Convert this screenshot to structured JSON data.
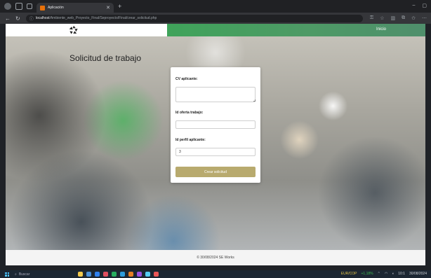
{
  "browser": {
    "tab_title": "Aplicación",
    "url_host": "localhost",
    "url_path": "/Ambiente_web_Proyecto_Final/Seproyecto/Final/crear_solicitud.php"
  },
  "header": {
    "nav_inicio": "Inicio"
  },
  "page": {
    "title": "Solicitud de trabajo"
  },
  "form": {
    "cv_label": "CV aplicante:",
    "cv_value": "",
    "oferta_label": "Id oferta trabajo:",
    "oferta_value": "",
    "perfil_label": "Id perfil aplicante:",
    "perfil_value": "3",
    "submit_label": "Crear solicitud"
  },
  "footer": {
    "text": "© 30/08/2024 SE Works"
  },
  "taskbar": {
    "search_label": "Buscar",
    "stock_label": "EUR/COP",
    "stock_change": "+1,18%",
    "time": "10:1",
    "date": "30/08/2024"
  },
  "colors": {
    "accent_green": "#3fa35a",
    "button_gold": "#b8aa6e"
  },
  "icons": {
    "logo": "aperture-logo-icon",
    "start": "windows-start-icon",
    "search": "search-icon"
  }
}
